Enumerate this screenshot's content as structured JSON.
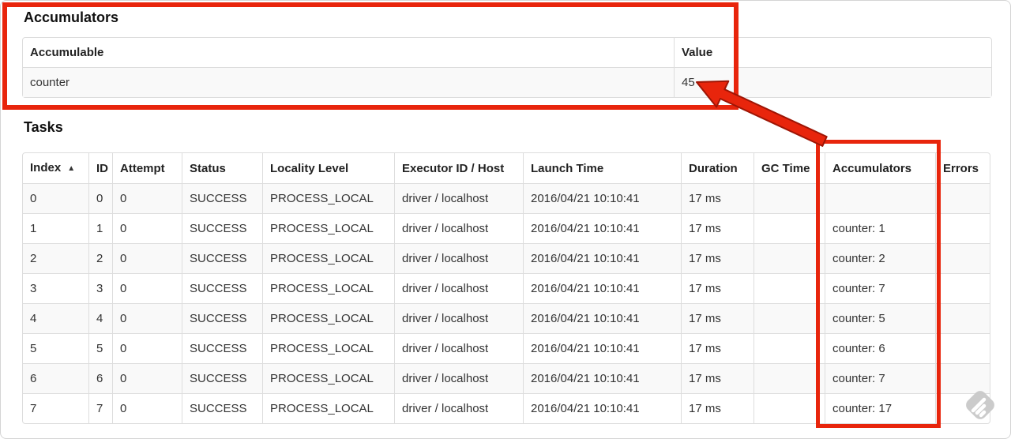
{
  "accumulators": {
    "heading": "Accumulators",
    "columns": [
      "Accumulable",
      "Value"
    ],
    "rows": [
      {
        "accumulable": "counter",
        "value": "45"
      }
    ]
  },
  "tasks": {
    "heading": "Tasks",
    "columns": [
      "Index",
      "ID",
      "Attempt",
      "Status",
      "Locality Level",
      "Executor ID / Host",
      "Launch Time",
      "Duration",
      "GC Time",
      "Accumulators",
      "Errors"
    ],
    "sorted_column": "Index",
    "sort_indicator": "▲",
    "rows": [
      [
        "0",
        "0",
        "0",
        "SUCCESS",
        "PROCESS_LOCAL",
        "driver / localhost",
        "2016/04/21 10:10:41",
        "17 ms",
        "",
        "",
        ""
      ],
      [
        "1",
        "1",
        "0",
        "SUCCESS",
        "PROCESS_LOCAL",
        "driver / localhost",
        "2016/04/21 10:10:41",
        "17 ms",
        "",
        "counter: 1",
        ""
      ],
      [
        "2",
        "2",
        "0",
        "SUCCESS",
        "PROCESS_LOCAL",
        "driver / localhost",
        "2016/04/21 10:10:41",
        "17 ms",
        "",
        "counter: 2",
        ""
      ],
      [
        "3",
        "3",
        "0",
        "SUCCESS",
        "PROCESS_LOCAL",
        "driver / localhost",
        "2016/04/21 10:10:41",
        "17 ms",
        "",
        "counter: 7",
        ""
      ],
      [
        "4",
        "4",
        "0",
        "SUCCESS",
        "PROCESS_LOCAL",
        "driver / localhost",
        "2016/04/21 10:10:41",
        "17 ms",
        "",
        "counter: 5",
        ""
      ],
      [
        "5",
        "5",
        "0",
        "SUCCESS",
        "PROCESS_LOCAL",
        "driver / localhost",
        "2016/04/21 10:10:41",
        "17 ms",
        "",
        "counter: 6",
        ""
      ],
      [
        "6",
        "6",
        "0",
        "SUCCESS",
        "PROCESS_LOCAL",
        "driver / localhost",
        "2016/04/21 10:10:41",
        "17 ms",
        "",
        "counter: 7",
        ""
      ],
      [
        "7",
        "7",
        "0",
        "SUCCESS",
        "PROCESS_LOCAL",
        "driver / localhost",
        "2016/04/21 10:10:41",
        "17 ms",
        "",
        "counter: 17",
        ""
      ]
    ]
  },
  "annotations": {
    "accent_color": "#e8250c",
    "outline_color": "#9e1505"
  },
  "icons": {
    "sort_ascending": "▲",
    "watermark": "striped-diamond"
  }
}
